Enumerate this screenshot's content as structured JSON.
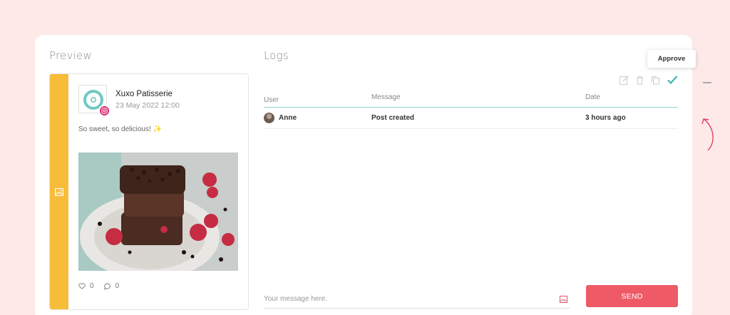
{
  "preview": {
    "title": "Preview",
    "account_name": "Xuxo Patisserie",
    "date": "23 May 2022 12:00",
    "text": "So sweet, so delicious! ✨",
    "likes": "0",
    "comments": "0",
    "platform_icon": "instagram-icon"
  },
  "logs": {
    "title": "Logs",
    "columns": [
      "User",
      "Message",
      "Date"
    ],
    "rows": [
      {
        "user": "Anne",
        "message": "Post created",
        "date": "3 hours ago"
      }
    ],
    "toolbar": {
      "tooltip": "Approve",
      "icons": [
        "edit-icon",
        "trash-icon",
        "copy-icon",
        "check-icon"
      ]
    },
    "input_placeholder": "Your message here.",
    "send_label": "SEND"
  },
  "colors": {
    "background": "#fde9e8",
    "strip": "#f7bd3a",
    "accent_teal": "#3fb8ae",
    "send": "#ef5a67",
    "instagram": "#d8246f"
  }
}
